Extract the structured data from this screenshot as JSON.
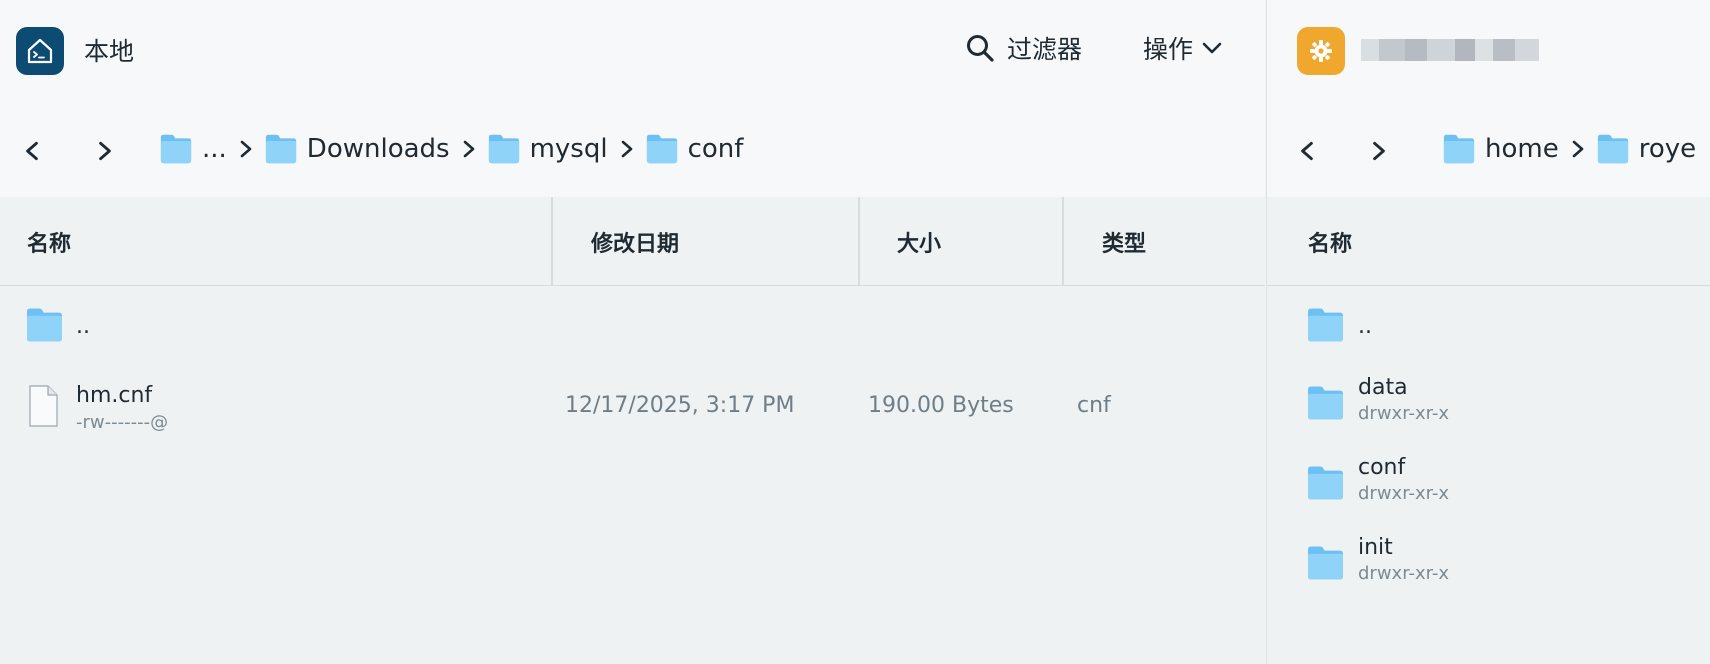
{
  "left_pane": {
    "title": "本地",
    "filter_label": "过滤器",
    "actions_label": "操作",
    "breadcrumbs": [
      {
        "label": "..."
      },
      {
        "label": "Downloads"
      },
      {
        "label": "mysql"
      },
      {
        "label": "conf"
      }
    ],
    "columns": {
      "name": "名称",
      "modified": "修改日期",
      "size": "大小",
      "type": "类型"
    },
    "rows": [
      {
        "name": "..",
        "permissions": "",
        "modified": "",
        "size": "",
        "type": "",
        "kind": "folder"
      },
      {
        "name": "hm.cnf",
        "permissions": "-rw-------@",
        "modified": "12/17/2025, 3:17 PM",
        "size": "190.00 Bytes",
        "type": "cnf",
        "kind": "file"
      }
    ]
  },
  "right_pane": {
    "breadcrumbs": [
      {
        "label": "home"
      },
      {
        "label": "roye"
      }
    ],
    "columns": {
      "name": "名称"
    },
    "rows": [
      {
        "name": "..",
        "permissions": "",
        "kind": "folder"
      },
      {
        "name": "data",
        "permissions": "drwxr-xr-x",
        "kind": "folder"
      },
      {
        "name": "conf",
        "permissions": "drwxr-xr-x",
        "kind": "folder"
      },
      {
        "name": "init",
        "permissions": "drwxr-xr-x",
        "kind": "folder"
      }
    ]
  },
  "icons": {
    "local": "terminal-home-icon",
    "remote": "server-gear-icon",
    "filter": "search-icon",
    "actions": "chevron-down-icon",
    "back": "chevron-left-icon",
    "forward": "chevron-right-icon",
    "folder": "folder-icon",
    "file": "file-icon"
  },
  "colors": {
    "local_icon_bg": "#0d4c72",
    "remote_icon_bg": "#f0a72e",
    "folder": "#7ccaf5",
    "header_bg": "#f6f8f9",
    "list_bg": "#eef2f2"
  }
}
